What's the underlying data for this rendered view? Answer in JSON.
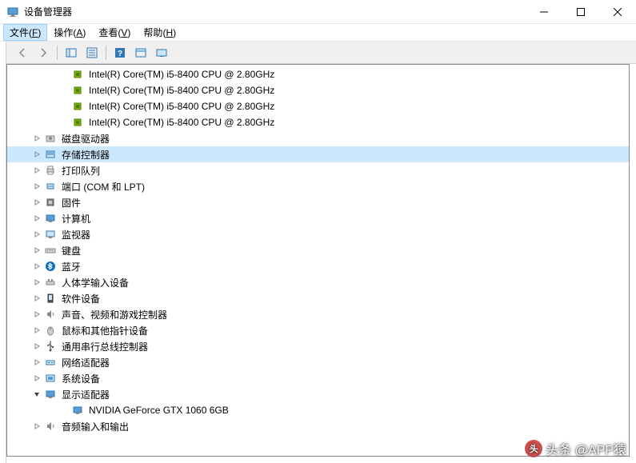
{
  "window": {
    "title": "设备管理器"
  },
  "menu": {
    "file": {
      "label": "文件",
      "key": "F"
    },
    "action": {
      "label": "操作",
      "key": "A"
    },
    "view": {
      "label": "查看",
      "key": "V"
    },
    "help": {
      "label": "帮助",
      "key": "H"
    }
  },
  "tree": {
    "cpu_items": [
      "Intel(R) Core(TM) i5-8400 CPU @ 2.80GHz",
      "Intel(R) Core(TM) i5-8400 CPU @ 2.80GHz",
      "Intel(R) Core(TM) i5-8400 CPU @ 2.80GHz",
      "Intel(R) Core(TM) i5-8400 CPU @ 2.80GHz"
    ],
    "categories": [
      {
        "name": "disk-drives",
        "label": "磁盘驱动器",
        "icon": "disk",
        "expandable": true
      },
      {
        "name": "storage-controllers",
        "label": "存储控制器",
        "icon": "storage",
        "expandable": true,
        "selected": true
      },
      {
        "name": "print-queues",
        "label": "打印队列",
        "icon": "printer",
        "expandable": true
      },
      {
        "name": "ports",
        "label": "端口 (COM 和 LPT)",
        "icon": "port",
        "expandable": true
      },
      {
        "name": "firmware",
        "label": "固件",
        "icon": "firmware",
        "expandable": true
      },
      {
        "name": "computer",
        "label": "计算机",
        "icon": "computer",
        "expandable": true
      },
      {
        "name": "monitors",
        "label": "监视器",
        "icon": "monitor",
        "expandable": true
      },
      {
        "name": "keyboards",
        "label": "键盘",
        "icon": "keyboard",
        "expandable": true
      },
      {
        "name": "bluetooth",
        "label": "蓝牙",
        "icon": "bluetooth",
        "expandable": true
      },
      {
        "name": "hid",
        "label": "人体学输入设备",
        "icon": "hid",
        "expandable": true
      },
      {
        "name": "software-devices",
        "label": "软件设备",
        "icon": "software",
        "expandable": true
      },
      {
        "name": "sound",
        "label": "声音、视频和游戏控制器",
        "icon": "sound",
        "expandable": true
      },
      {
        "name": "mice",
        "label": "鼠标和其他指针设备",
        "icon": "mouse",
        "expandable": true
      },
      {
        "name": "usb",
        "label": "通用串行总线控制器",
        "icon": "usb",
        "expandable": true
      },
      {
        "name": "network",
        "label": "网络适配器",
        "icon": "network",
        "expandable": true
      },
      {
        "name": "system",
        "label": "系统设备",
        "icon": "system",
        "expandable": true
      },
      {
        "name": "display",
        "label": "显示适配器",
        "icon": "display",
        "expandable": true,
        "expanded": true,
        "children": [
          {
            "name": "gpu-nvidia",
            "label": "NVIDIA GeForce GTX 1060 6GB",
            "icon": "display"
          }
        ]
      },
      {
        "name": "audio-io",
        "label": "音频输入和输出",
        "icon": "sound",
        "expandable": true
      }
    ]
  },
  "watermark": "头条 @APP猿"
}
